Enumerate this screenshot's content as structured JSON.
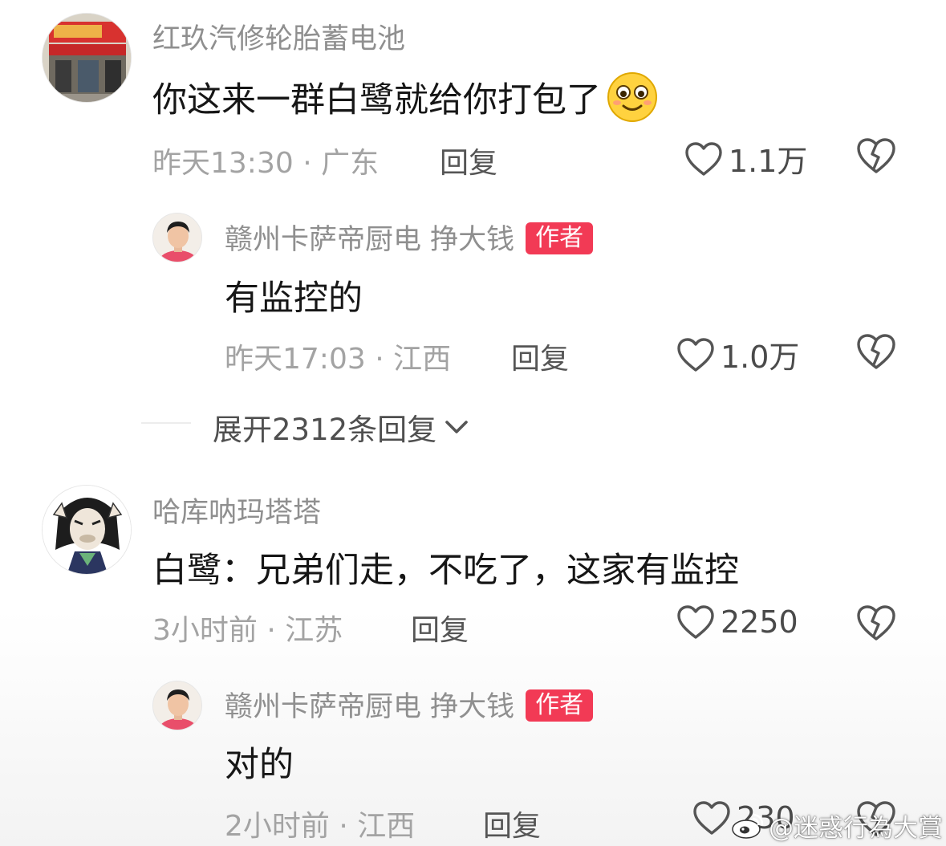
{
  "comments": [
    {
      "user": "红玖汽修轮胎蓄电池",
      "text": "你这来一群白鹭就给你打包了",
      "emoji": "smile-emoji",
      "time": "昨天13:30 · 广东",
      "reply_label": "回复",
      "likes": "1.1万",
      "replies": [
        {
          "user": "赣州卡萨帝厨电 挣大钱",
          "badge": "作者",
          "text": "有监控的",
          "time": "昨天17:03 · 江西",
          "reply_label": "回复",
          "likes": "1.0万"
        }
      ],
      "expand_label": "展开2312条回复"
    },
    {
      "user": "哈库呐玛塔塔",
      "text": "白鹭：兄弟们走，不吃了，这家有监控",
      "time": "3小时前 · 江苏",
      "reply_label": "回复",
      "likes": "2250",
      "replies": [
        {
          "user": "赣州卡萨帝厨电 挣大钱",
          "badge": "作者",
          "text": "对的",
          "time": "2小时前 · 江西",
          "reply_label": "回复",
          "likes": "230"
        }
      ]
    }
  ],
  "watermark": "@迷惑行為大賞",
  "colors": {
    "badge": "#f23a55",
    "name": "#8f8f8f",
    "meta": "#a3a3a3",
    "text": "#161616"
  },
  "icons": [
    "heart-outline-icon",
    "broken-heart-icon",
    "chevron-down-icon",
    "weibo-logo-icon"
  ]
}
